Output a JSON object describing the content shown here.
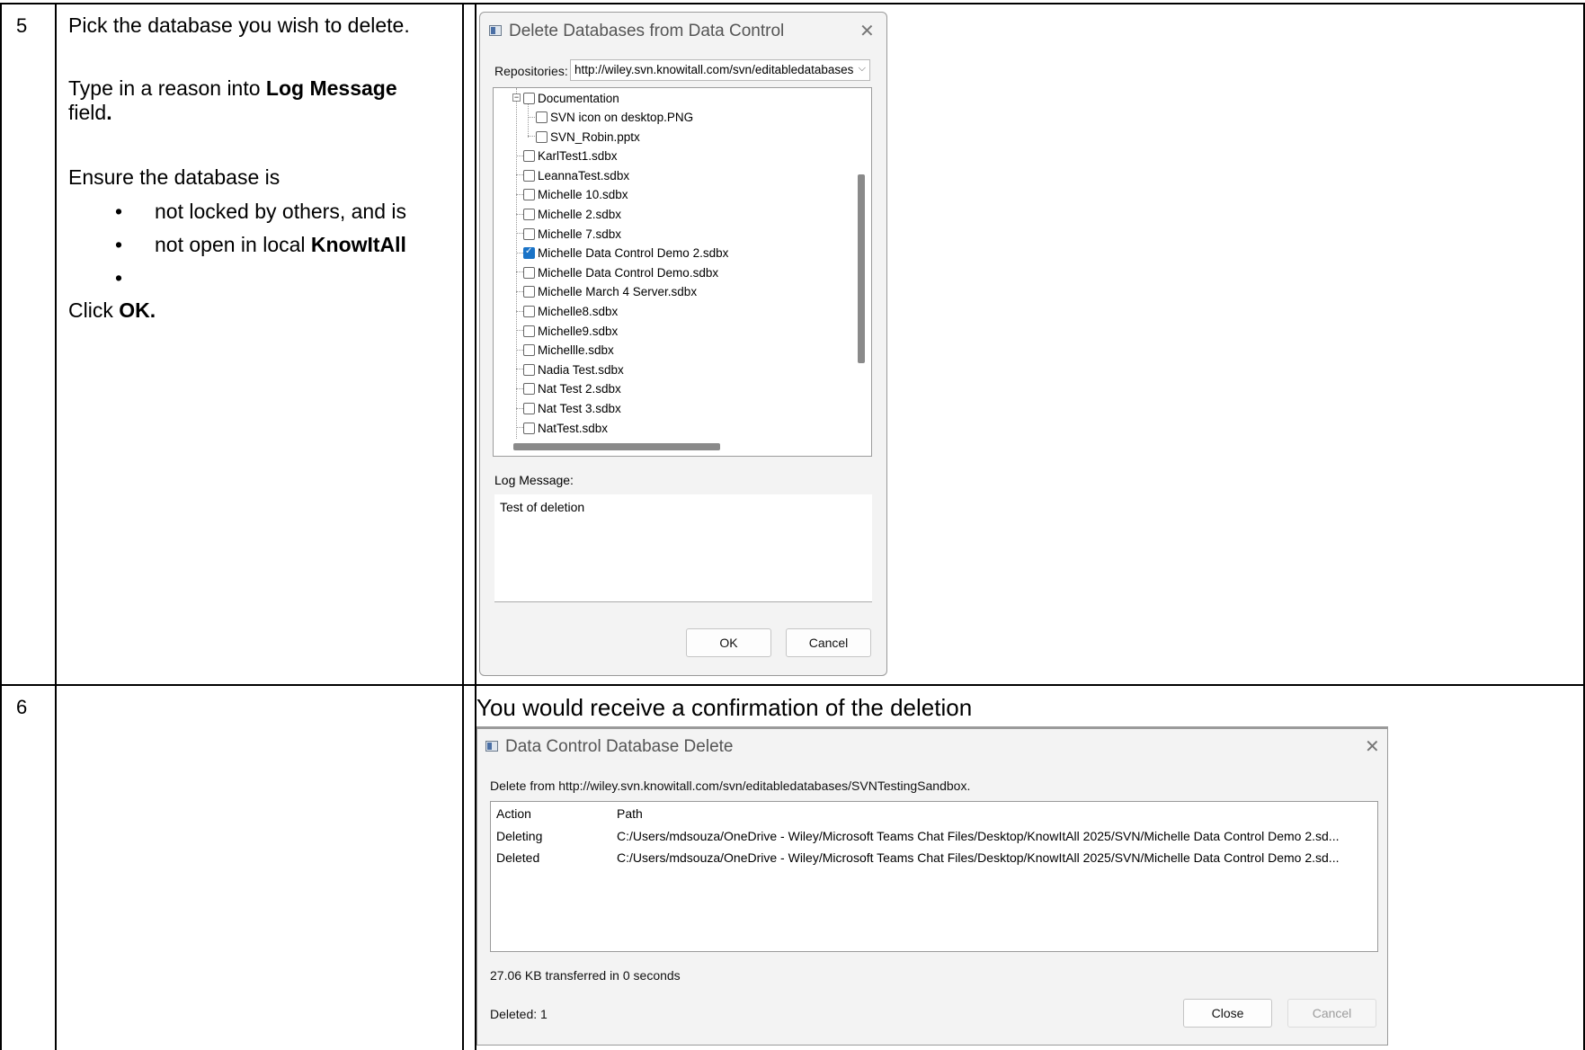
{
  "steps": [
    {
      "number": "5",
      "instructions": {
        "line1": "Pick the database you wish to delete.",
        "line2_pre": "Type in a reason into ",
        "line2_bold": "Log Message",
        "line2_post": "field",
        "line2_dot": ".",
        "line3": "Ensure the database is",
        "bullets": [
          "not locked by others, and is",
          "not open in local ",
          ""
        ],
        "bullet2_bold": "KnowItAll",
        "line4_pre": "Click ",
        "line4_bold": "OK."
      }
    },
    {
      "number": "6",
      "heading": "You would receive a confirmation of the deletion"
    }
  ],
  "delete_dialog": {
    "title": "Delete Databases from Data Control",
    "repositories_label": "Repositories:",
    "repositories_value": "http://wiley.svn.knowitall.com/svn/editabledatabases",
    "tree_items": [
      {
        "label": "Documentation",
        "checked": false
      },
      {
        "label": "SVN icon on desktop.PNG",
        "checked": false
      },
      {
        "label": "SVN_Robin.pptx",
        "checked": false
      },
      {
        "label": "KarlTest1.sdbx",
        "checked": false
      },
      {
        "label": "LeannaTest.sdbx",
        "checked": false
      },
      {
        "label": "Michelle 10.sdbx",
        "checked": false
      },
      {
        "label": "Michelle 2.sdbx",
        "checked": false
      },
      {
        "label": "Michelle 7.sdbx",
        "checked": false
      },
      {
        "label": "Michelle Data Control Demo 2.sdbx",
        "checked": true
      },
      {
        "label": "Michelle Data Control Demo.sdbx",
        "checked": false
      },
      {
        "label": "Michelle March 4 Server.sdbx",
        "checked": false
      },
      {
        "label": "Michelle8.sdbx",
        "checked": false
      },
      {
        "label": "Michelle9.sdbx",
        "checked": false
      },
      {
        "label": "Michellle.sdbx",
        "checked": false
      },
      {
        "label": "Nadia Test.sdbx",
        "checked": false
      },
      {
        "label": "Nat Test 2.sdbx",
        "checked": false
      },
      {
        "label": "Nat Test 3.sdbx",
        "checked": false
      },
      {
        "label": "NatTest.sdbx",
        "checked": false
      }
    ],
    "log_message_label": "Log Message:",
    "log_message_value": "Test of deletion",
    "ok_label": "OK",
    "cancel_label": "Cancel"
  },
  "confirm_dialog": {
    "title": "Data Control Database Delete",
    "delete_from": "Delete from http://wiley.svn.knowitall.com/svn/editabledatabases/SVNTestingSandbox.",
    "columns": [
      "Action",
      "Path"
    ],
    "rows": [
      {
        "action": "Deleting",
        "path": "C:/Users/mdsouza/OneDrive - Wiley/Microsoft Teams Chat Files/Desktop/KnowItAll 2025/SVN/Michelle Data Control Demo 2.sd..."
      },
      {
        "action": "Deleted",
        "path": "C:/Users/mdsouza/OneDrive - Wiley/Microsoft Teams Chat Files/Desktop/KnowItAll 2025/SVN/Michelle Data Control Demo 2.sd..."
      }
    ],
    "transfer_text": "27.06 KB transferred in 0 seconds",
    "deleted_count": "Deleted: 1",
    "close_label": "Close",
    "cancel_label": "Cancel"
  }
}
